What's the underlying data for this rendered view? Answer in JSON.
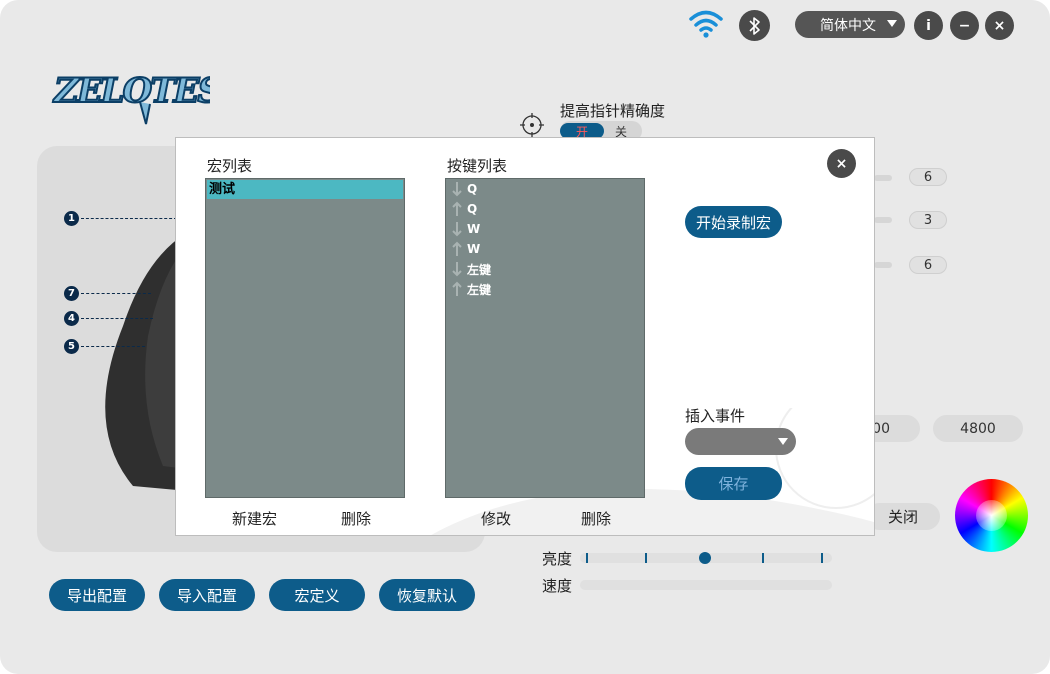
{
  "topbar": {
    "language": "简体中文",
    "info_label": "i",
    "minimize_label": "−",
    "close_label": "×"
  },
  "logo": {
    "text": "ZELOTES"
  },
  "callouts": [
    "1",
    "7",
    "4",
    "5"
  ],
  "precision": {
    "label": "提高指针精确度",
    "on_label": "开",
    "off_label": "关"
  },
  "behind_values": {
    "v1": "6",
    "v2": "3",
    "v3": "6"
  },
  "dpi": {
    "partial": "00",
    "value": "4800"
  },
  "lighting": {
    "off_label": "关闭",
    "brightness_label": "亮度",
    "speed_label": "速度"
  },
  "bottom_buttons": {
    "export": "导出配置",
    "import": "导入配置",
    "macro": "宏定义",
    "reset": "恢复默认"
  },
  "modal": {
    "close_label": "×",
    "macro_list_title": "宏列表",
    "key_list_title": "按键列表",
    "macros": [
      "测试"
    ],
    "keys": [
      {
        "dir": "down",
        "key": "Q"
      },
      {
        "dir": "up",
        "key": "Q"
      },
      {
        "dir": "down",
        "key": "W"
      },
      {
        "dir": "up",
        "key": "W"
      },
      {
        "dir": "down",
        "key": "左键"
      },
      {
        "dir": "up",
        "key": "左键"
      }
    ],
    "new_macro": "新建宏",
    "delete_macro": "删除",
    "modify_key": "修改",
    "delete_key": "删除",
    "record_button": "开始录制宏",
    "insert_event_label": "插入事件",
    "insert_event_value": "",
    "save_button": "保存"
  },
  "colors": {
    "accent": "#0d5c8a",
    "list_bg": "#7c8a89",
    "selected": "#4cb8c2"
  }
}
